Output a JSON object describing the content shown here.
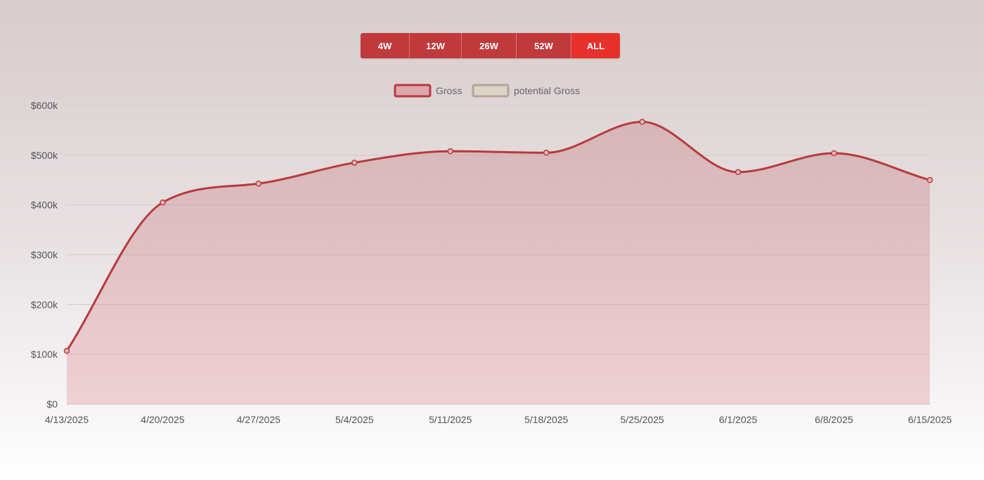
{
  "range_tabs": [
    {
      "label": "4W",
      "active": false
    },
    {
      "label": "12W",
      "active": false
    },
    {
      "label": "26W",
      "active": false
    },
    {
      "label": "52W",
      "active": false
    },
    {
      "label": "ALL",
      "active": true
    }
  ],
  "colors": {
    "gross_line": "#b83a3c",
    "gross_fill": "#d69b9f",
    "potential_line": "#b5a592",
    "potential_fill": "#d9d2c8",
    "tab_bg": "#c0393b",
    "tab_active_bg": "#e8302a",
    "grid": "#d4caca"
  },
  "chart_data": {
    "type": "area",
    "title": "",
    "xlabel": "",
    "ylabel": "",
    "ylim": [
      0,
      600000
    ],
    "yticks": [
      0,
      100000,
      200000,
      300000,
      400000,
      500000,
      600000
    ],
    "ytick_labels": [
      "$0",
      "$100k",
      "$200k",
      "$300k",
      "$400k",
      "$500k",
      "$600k"
    ],
    "x": [
      "4/13/2025",
      "4/20/2025",
      "4/27/2025",
      "5/4/2025",
      "5/11/2025",
      "5/18/2025",
      "5/25/2025",
      "6/1/2025",
      "6/8/2025",
      "6/15/2025"
    ],
    "grid": true,
    "legend_position": "top-center",
    "series": [
      {
        "name": "Gross",
        "values": [
          107000,
          405000,
          443000,
          485000,
          508000,
          505000,
          567000,
          466000,
          504000,
          450000
        ]
      },
      {
        "name": "potential Gross",
        "values": []
      }
    ]
  }
}
